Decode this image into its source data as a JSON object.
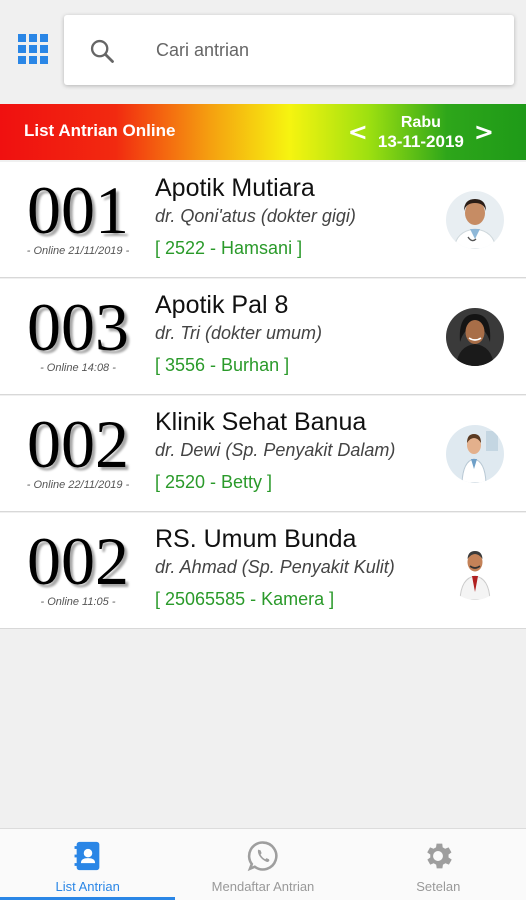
{
  "search": {
    "placeholder": "Cari antrian"
  },
  "header": {
    "title": "List Antrian Online",
    "day": "Rabu",
    "date": "13-11-2019",
    "prev_arrow": "<",
    "next_arrow": ">"
  },
  "queues": [
    {
      "number": "001",
      "meta": "- Online 21/11/2019 -",
      "place": "Apotik Mutiara",
      "doctor": "dr. Qoni'atus (dokter gigi)",
      "patient": "[ 2522 - Hamsani ]",
      "avatar": "female-doctor-avatar"
    },
    {
      "number": "003",
      "meta": "- Online 14:08 -",
      "place": "Apotik Pal 8",
      "doctor": "dr. Tri (dokter umum)",
      "patient": "[ 3556 - Burhan ]",
      "avatar": "woman-avatar"
    },
    {
      "number": "002",
      "meta": "- Online 22/11/2019 -",
      "place": "Klinik Sehat Banua",
      "doctor": "dr. Dewi (Sp. Penyakit Dalam)",
      "patient": "[ 2520 - Betty ]",
      "avatar": "doctor-avatar"
    },
    {
      "number": "002",
      "meta": "- Online 11:05 -",
      "place": "RS. Umum Bunda",
      "doctor": "dr. Ahmad (Sp. Penyakit Kulit)",
      "patient": "[ 25065585 - Kamera ]",
      "avatar": "male-doctor-avatar"
    }
  ],
  "nav": {
    "items": [
      {
        "label": "List Antrian",
        "icon": "contact-book-icon",
        "active": true
      },
      {
        "label": "Mendaftar Antrian",
        "icon": "whatsapp-icon",
        "active": false
      },
      {
        "label": "Setelan",
        "icon": "gear-icon",
        "active": false
      }
    ]
  },
  "colors": {
    "accent": "#2a86e6",
    "patient_text": "#2a9a2a",
    "header_gradient": [
      "#f01010",
      "#f6f410",
      "#1e9a18"
    ]
  }
}
